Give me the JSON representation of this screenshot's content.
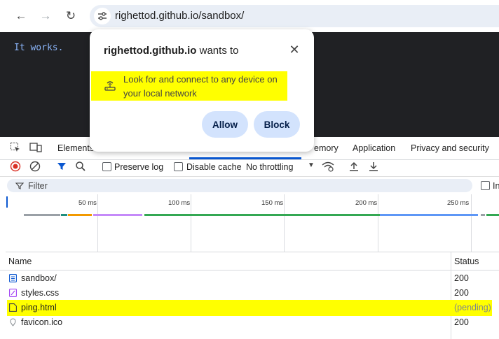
{
  "browser": {
    "url": "righettod.github.io/sandbox/"
  },
  "page": {
    "content": "It works."
  },
  "popup": {
    "site": "righettod.github.io",
    "title_suffix": " wants to",
    "permission_line1": "Look for and connect to any device on",
    "permission_line2": "your local network",
    "allow_label": "Allow",
    "block_label": "Block"
  },
  "devtools": {
    "tabs": [
      "Elements",
      "emory",
      "Application",
      "Privacy and security"
    ],
    "toolbar": {
      "preserve_log": "Preserve log",
      "disable_cache": "Disable cache",
      "throttling": "No throttling"
    },
    "filter_placeholder": "Filter",
    "filter_right": "In",
    "timeline_ticks": [
      "50 ms",
      "100 ms",
      "150 ms",
      "200 ms",
      "250 ms"
    ],
    "columns": {
      "name": "Name",
      "status": "Status"
    },
    "rows": [
      {
        "name": "sandbox/",
        "status": "200"
      },
      {
        "name": "styles.css",
        "status": "200"
      },
      {
        "name": "ping.html",
        "status": "(pending)"
      },
      {
        "name": "favicon.ico",
        "status": "200"
      }
    ]
  },
  "colors": {
    "highlight": "#ffff00",
    "button_bg": "#d3e3fd",
    "page_bg": "#202124",
    "page_text": "#8ab4f8"
  }
}
